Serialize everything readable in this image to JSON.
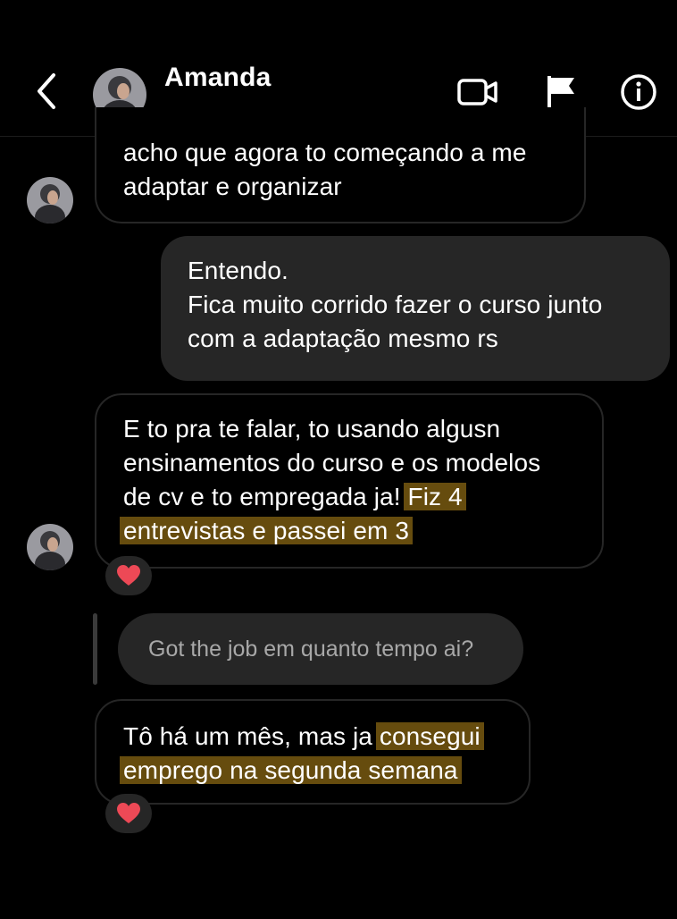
{
  "header": {
    "contact_name": "Amanda"
  },
  "messages": [
    {
      "direction": "incoming",
      "lines": [
        "acho que agora to começando a me",
        "adaptar e organizar"
      ]
    },
    {
      "direction": "outgoing",
      "lines": [
        "Entendo.",
        "Fica muito corrido fazer o curso junto",
        "com a adaptação mesmo rs"
      ]
    },
    {
      "direction": "incoming",
      "line1": "E to pra te falar, to usando algusn",
      "line2": "ensinamentos do curso e os modelos",
      "line3_plain": "de cv e to empregada ja! ",
      "line3_highlight": "Fiz 4",
      "line4_highlight": "entrevistas e passei em 3",
      "reaction": "❤️"
    },
    {
      "direction": "reply",
      "text": "Got the job em quanto tempo ai?"
    },
    {
      "direction": "incoming",
      "line1_plain": "Tô há um mês, mas ja ",
      "line1_highlight": "consegui",
      "line2_highlight": "emprego na segunda semana",
      "reaction": "❤️"
    }
  ],
  "icons": {
    "back": "chevron-left-icon",
    "video": "video-camera-icon",
    "flag": "flag-icon",
    "info": "info-icon"
  },
  "colors": {
    "background": "#000000",
    "outgoing_bubble": "#262626",
    "incoming_border": "#262626",
    "highlight": "#664c0e",
    "heart": "#ed4956"
  }
}
